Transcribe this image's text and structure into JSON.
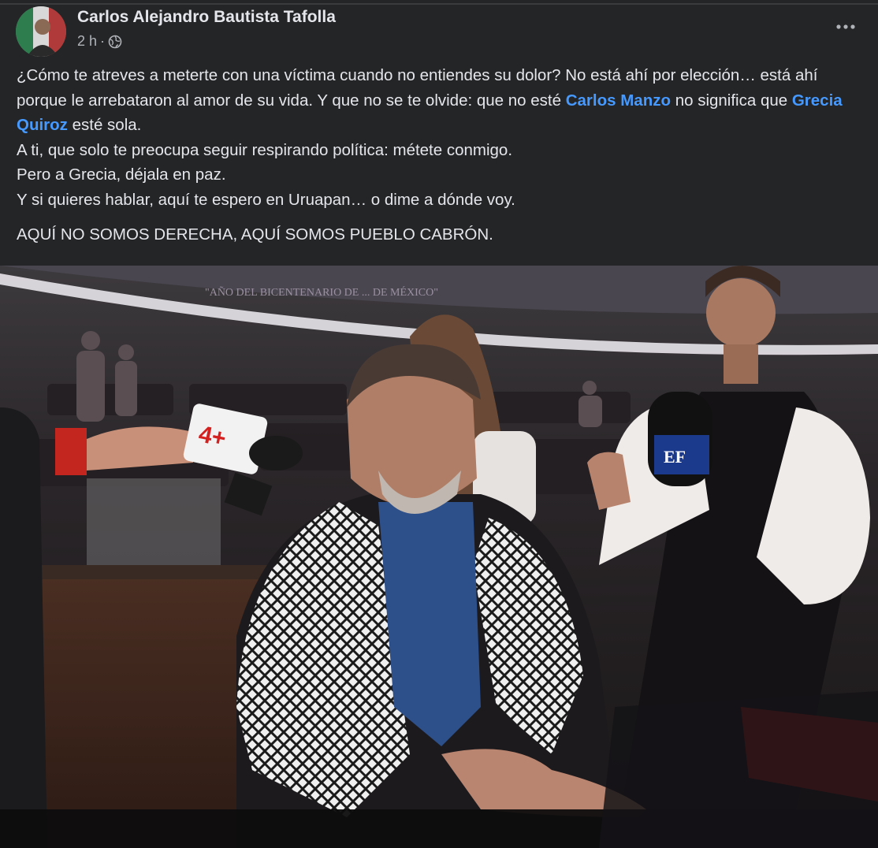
{
  "post": {
    "author": "Carlos Alejandro Bautista Tafolla",
    "time": "2 h",
    "separator": "·",
    "privacy_icon": "globe-icon",
    "menu_icon": "more-options-icon",
    "text": {
      "line1": "¿Cómo te atreves a meterte con una víctima cuando no entiendes su dolor? No está ahí por elección… está ahí porque le arrebataron al amor de su vida. Y que no se te olvide: que no esté ",
      "mention1": "Carlos Manzo",
      "line1_mid": " no significa que ",
      "mention2": "Grecia Quiroz",
      "line1_end": " esté sola.",
      "line2": "A ti, que solo te preocupa seguir respirando política: métete conmigo.",
      "line3": "Pero a Grecia, déjala en paz.",
      "line4": "Y si quieres hablar, aquí te espero en Uruapan… o dime a dónde voy.",
      "line5": "AQUÍ NO SOMOS DERECHA, AQUÍ SOMOS PUEBLO CABRÓN."
    }
  },
  "photo": {
    "wall_inscription": "\"AÑO DEL BICENTENARIO DE ... DE MÉXICO\"",
    "mic_left_logo": "4+",
    "mic_right_logo": "EF"
  },
  "colors": {
    "background": "#242526",
    "text": "#e4e6eb",
    "secondary_text": "#b0b3b8",
    "mention": "#4599ff"
  }
}
